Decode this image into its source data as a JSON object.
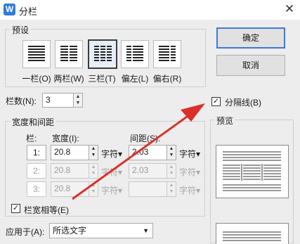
{
  "window": {
    "title": "分栏",
    "app_icon_letter": "W"
  },
  "presets": {
    "group_label": "预设",
    "items": [
      {
        "label": "一栏(O)",
        "columns": 1
      },
      {
        "label": "两栏(W)",
        "columns": 2
      },
      {
        "label": "三栏(T)",
        "columns": 3
      },
      {
        "label": "偏左(L)",
        "columns": 2
      },
      {
        "label": "偏右(R)",
        "columns": 2
      }
    ],
    "selected_index": 2
  },
  "buttons": {
    "ok": "确定",
    "cancel": "取消"
  },
  "column_count": {
    "label": "栏数(N):",
    "value": "3"
  },
  "separator": {
    "label": "分隔线(B)",
    "checked": true
  },
  "width_spacing": {
    "group_label": "宽度和间距",
    "col_header": "栏:",
    "width_header": "宽度(I):",
    "spacing_header": "间距(S):",
    "rows": [
      {
        "num": "1:",
        "width": "20.8",
        "width_unit": "字符",
        "spacing": "2.03",
        "spacing_unit": "字符",
        "enabled": true
      },
      {
        "num": "2:",
        "width": "20.8",
        "width_unit": "字符",
        "spacing": "2.03",
        "spacing_unit": "字符",
        "enabled": false
      },
      {
        "num": "3:",
        "width": "20.8",
        "width_unit": "字符",
        "spacing": "",
        "spacing_unit": "字符",
        "enabled": false
      }
    ],
    "equal_width": {
      "label": "栏宽相等(E)",
      "checked": true
    }
  },
  "apply_to": {
    "label": "应用于(A):",
    "value": "所选文字"
  },
  "preview": {
    "label": "预览"
  },
  "colors": {
    "accent": "#3d7ad6",
    "arrow": "#d9302b"
  }
}
